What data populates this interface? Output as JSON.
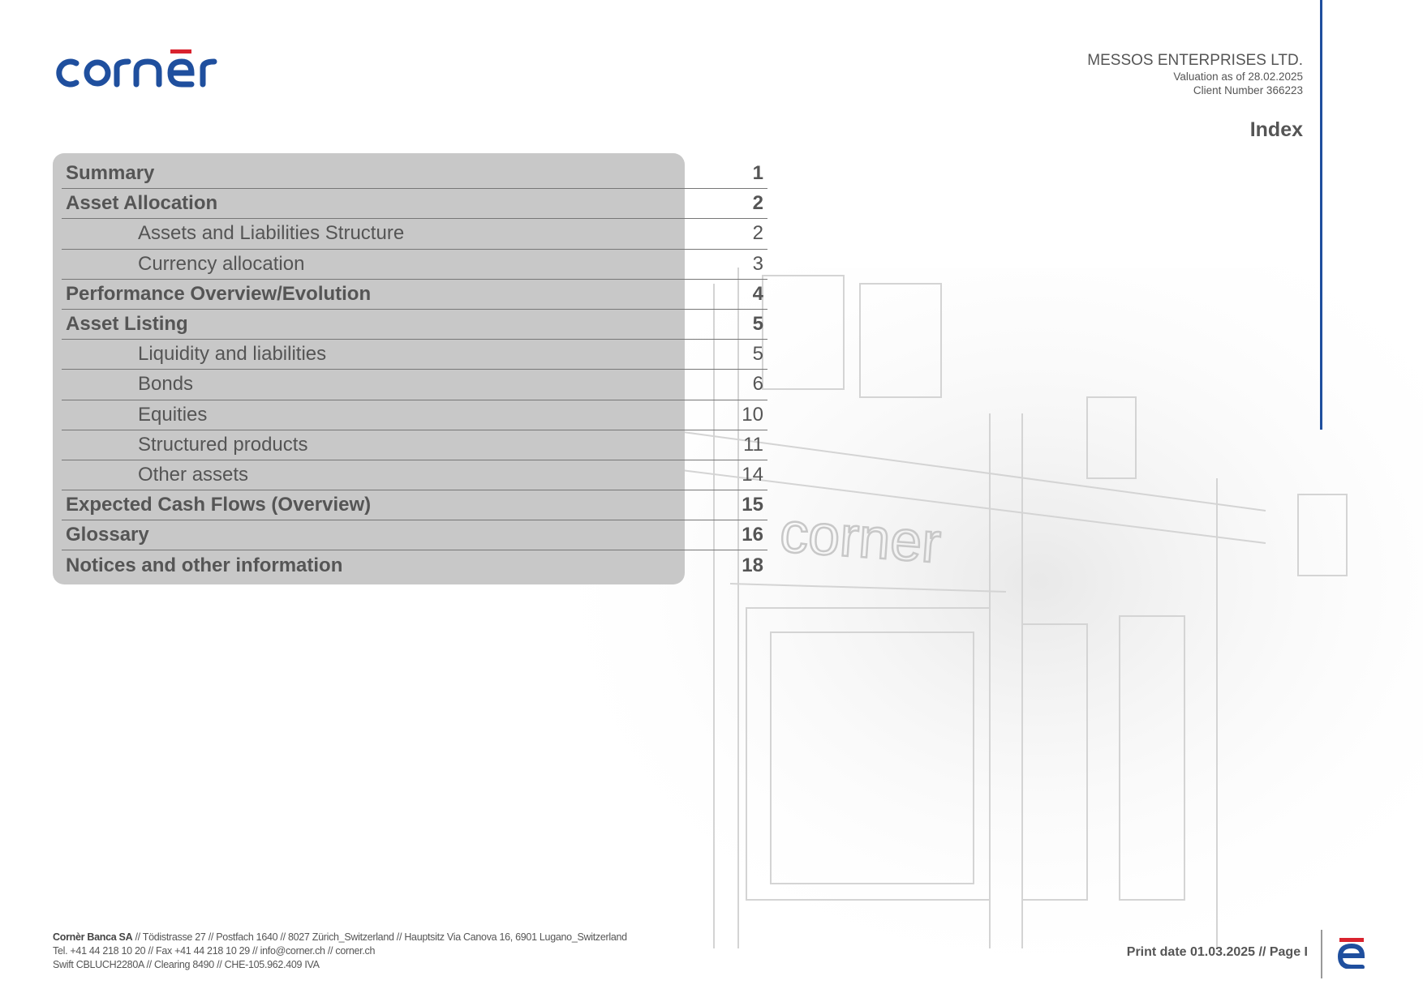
{
  "brand": {
    "logo_text": "cornèr",
    "primary_color": "#1f4f9e",
    "accent_color": "#d9232e"
  },
  "client": {
    "name": "MESSOS ENTERPRISES LTD.",
    "valuation": "Valuation as of 28.02.2025",
    "client_number": "Client Number 366223"
  },
  "page_title": "Index",
  "toc": [
    {
      "label": "Summary",
      "page": "1",
      "level": "main"
    },
    {
      "label": "Asset Allocation",
      "page": "2",
      "level": "main"
    },
    {
      "label": "Assets and Liabilities Structure",
      "page": "2",
      "level": "sub"
    },
    {
      "label": "Currency allocation",
      "page": "3",
      "level": "sub"
    },
    {
      "label": "Performance Overview/Evolution",
      "page": "4",
      "level": "main"
    },
    {
      "label": "Asset Listing",
      "page": "5",
      "level": "main"
    },
    {
      "label": "Liquidity and liabilities",
      "page": "5",
      "level": "sub"
    },
    {
      "label": "Bonds",
      "page": "6",
      "level": "sub"
    },
    {
      "label": "Equities",
      "page": "10",
      "level": "sub"
    },
    {
      "label": "Structured products",
      "page": "11",
      "level": "sub"
    },
    {
      "label": "Other assets",
      "page": "14",
      "level": "sub"
    },
    {
      "label": "Expected Cash Flows (Overview)",
      "page": "15",
      "level": "main"
    },
    {
      "label": "Glossary",
      "page": "16",
      "level": "main"
    },
    {
      "label": "Notices and other information",
      "page": "18",
      "level": "main"
    }
  ],
  "footer": {
    "company": "Cornèr Banca SA",
    "line1_rest": " // Tödistrasse 27 // Postfach 1640 // 8027 Zürich_Switzerland // Hauptsitz Via Canova 16, 6901 Lugano_Switzerland",
    "line2": "Tel. +41 44 218 10 20 // Fax +41 44 218 10 29 // info@corner.ch // corner.ch",
    "line3": "Swift CBLUCH2280A // Clearing 8490 // CHE-105.962.409 IVA",
    "print_info": "Print date 01.03.2025 // Page I"
  }
}
